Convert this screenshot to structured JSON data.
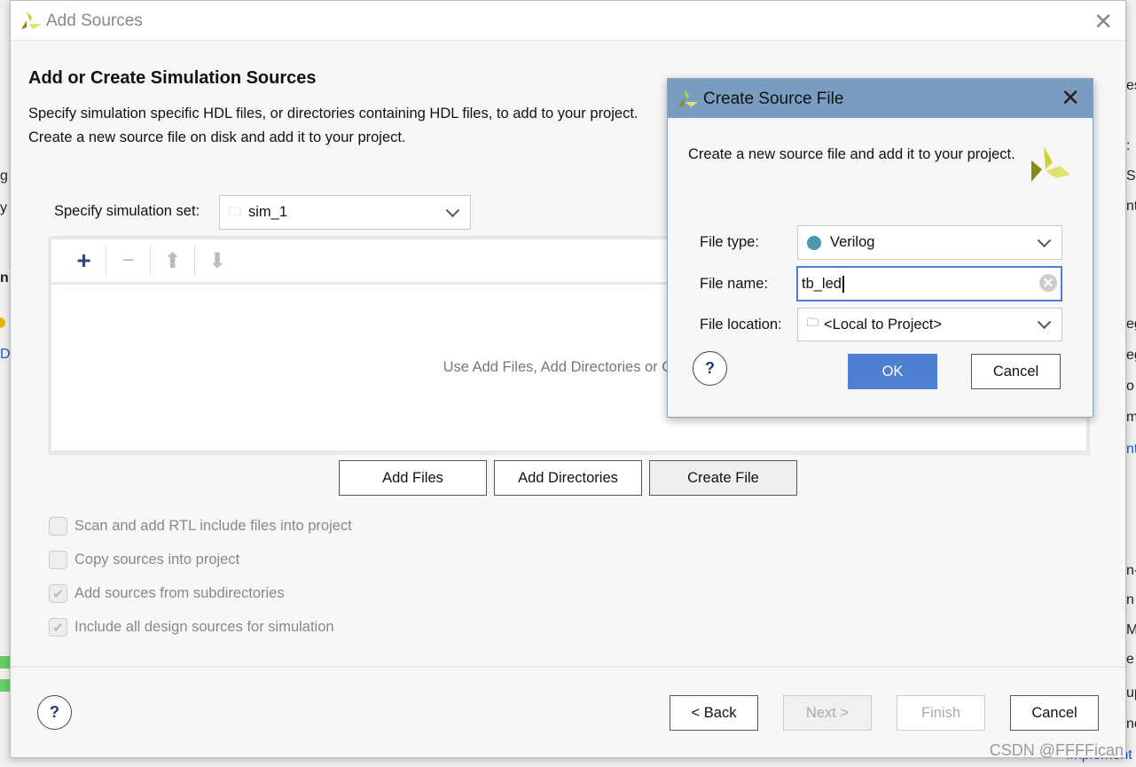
{
  "background": {
    "left": [
      "g",
      "y",
      "n",
      "D"
    ],
    "right": [
      "es",
      ":",
      "St",
      "nt",
      "eg",
      "eg",
      "o",
      "m",
      "nt",
      "n-",
      "n",
      "M",
      "e",
      "up",
      "nc",
      "Implement"
    ]
  },
  "main_dialog": {
    "title": "Add Sources",
    "heading": "Add or Create Simulation Sources",
    "description": "Specify simulation specific HDL files, or directories containing HDL files, to add to your project. Create a new source file on disk and add it to your project.",
    "sim_set_label": "Specify simulation set:",
    "sim_set_value": "sim_1",
    "toolbar": {
      "add": "+",
      "remove": "−",
      "up": "⬆",
      "down": "⬇"
    },
    "empty_hint": "Use Add Files, Add Directories or Create File buttons below",
    "buttons": {
      "add_files": "Add Files",
      "add_directories": "Add Directories",
      "create_file": "Create File"
    },
    "options": [
      {
        "label": "Scan and add RTL include files into project",
        "checked": false
      },
      {
        "label": "Copy sources into project",
        "checked": false
      },
      {
        "label": "Add sources from subdirectories",
        "checked": true
      },
      {
        "label": "Include all design sources for simulation",
        "checked": true
      }
    ],
    "help": "?",
    "nav": {
      "back": "< Back",
      "next": "Next >",
      "finish": "Finish",
      "cancel": "Cancel"
    }
  },
  "create_source_dialog": {
    "title": "Create Source File",
    "description": "Create a new source file and add it to your project.",
    "file_type_label": "File type:",
    "file_type_value": "Verilog",
    "file_type_color": "#4a97b0",
    "file_name_label": "File name:",
    "file_name_value": "tb_led",
    "file_location_label": "File location:",
    "file_location_value": "<Local to Project>",
    "help": "?",
    "ok": "OK",
    "cancel": "Cancel"
  },
  "watermark": "CSDN @FFFFican"
}
